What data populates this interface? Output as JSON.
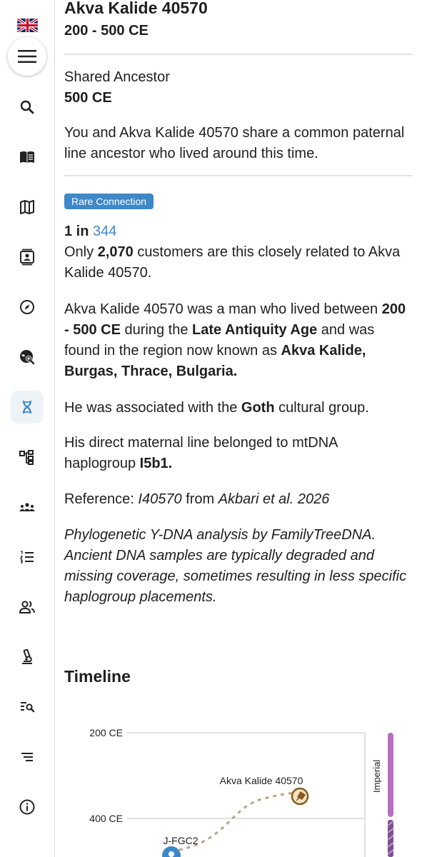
{
  "sidebar": {
    "flag_icon": "uk-flag-icon",
    "menu_icon": "hamburger-icon",
    "items": [
      {
        "name": "search",
        "icon": "search-icon"
      },
      {
        "name": "book",
        "icon": "book-icon"
      },
      {
        "name": "map",
        "icon": "map-icon"
      },
      {
        "name": "profile-card",
        "icon": "contact-card-icon"
      },
      {
        "name": "compass",
        "icon": "compass-icon"
      },
      {
        "name": "globe-search",
        "icon": "globe-search-icon"
      },
      {
        "name": "dna",
        "icon": "dna-icon",
        "active": true
      },
      {
        "name": "tree",
        "icon": "tree-diagram-icon"
      },
      {
        "name": "groups",
        "icon": "groups-icon"
      },
      {
        "name": "list",
        "icon": "numbered-list-icon"
      },
      {
        "name": "people",
        "icon": "people-icon"
      },
      {
        "name": "microscope",
        "icon": "microscope-icon"
      },
      {
        "name": "list-search",
        "icon": "list-search-icon"
      },
      {
        "name": "sort",
        "icon": "sort-lines-icon"
      },
      {
        "name": "info",
        "icon": "info-icon"
      }
    ]
  },
  "header": {
    "title": "Akva Kalide 40570",
    "date_range": "200 - 500 CE"
  },
  "shared_ancestor": {
    "label": "Shared Ancestor",
    "date": "500 CE",
    "description": "You and Akva Kalide 40570 share a common paternal line ancestor who lived around this time."
  },
  "connection": {
    "badge": "Rare Connection",
    "ratio_prefix": "1 in",
    "ratio_value": "344",
    "customers_pre": "Only",
    "customers_count": "2,070",
    "customers_post": "customers are this closely related to Akva Kalide 40570."
  },
  "bio": {
    "p1_a": "Akva Kalide 40570 was a man who lived between",
    "p1_dates": "200 - 500 CE",
    "p1_b": "during the",
    "p1_age": "Late Antiquity Age",
    "p1_c": "and was found in the region now known as",
    "p1_region": "Akva Kalide, Burgas, Thrace, Bulgaria.",
    "p2_a": "He was associated with the",
    "p2_group": "Goth",
    "p2_b": "cultural group.",
    "p3_a": "His direct maternal line belonged to mtDNA haplogroup",
    "p3_hap": "I5b1.",
    "ref_label": "Reference:",
    "ref_id": "I40570",
    "ref_mid": "from",
    "ref_source": "Akbari et al. 2026",
    "note": "Phylogenetic Y-DNA analysis by FamilyTreeDNA. Ancient DNA samples are typically degraded and missing coverage, sometimes resulting in less specific haplogroup placements."
  },
  "timeline": {
    "title": "Timeline",
    "tick_200": "200 CE",
    "tick_400": "400 CE",
    "sample_label": "Akva Kalide 40570",
    "haplogroup_label": "J-FGC2",
    "era_label": "Imperial",
    "sample_icon": "trowel-icon",
    "haplogroup_icon": "location-pin-icon",
    "colors": {
      "imperial": "#b86dc4",
      "sample_border": "#8a5a1e",
      "pin": "#3d88c9",
      "path": "#b8a488"
    }
  }
}
